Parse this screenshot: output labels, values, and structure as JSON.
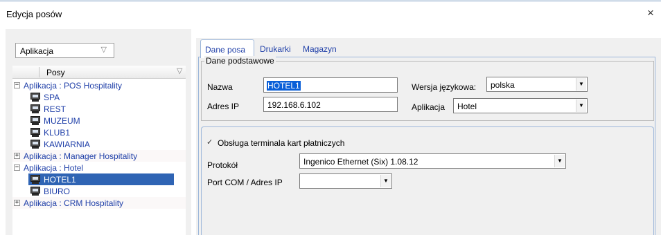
{
  "window": {
    "title": "Edycja posów",
    "close_glyph": "×"
  },
  "left": {
    "filter_combo": {
      "value": "Aplikacja",
      "arrow": "▽"
    },
    "tree_header": {
      "label": "Posy",
      "arrow": "▽"
    },
    "tree": [
      {
        "type": "group",
        "label": "Aplikacja : POS Hospitality",
        "expander": "−"
      },
      {
        "type": "leaf",
        "label": "SPA"
      },
      {
        "type": "leaf",
        "label": "REST"
      },
      {
        "type": "leaf",
        "label": "MUZEUM"
      },
      {
        "type": "leaf",
        "label": "KLUB1"
      },
      {
        "type": "leaf",
        "label": "KAWIARNIA"
      },
      {
        "type": "group",
        "label": "Aplikacja : Manager Hospitality",
        "expander": "+"
      },
      {
        "type": "group",
        "label": "Aplikacja : Hotel",
        "expander": "−"
      },
      {
        "type": "leaf",
        "label": "HOTEL1",
        "selected": true
      },
      {
        "type": "leaf",
        "label": "BIURO"
      },
      {
        "type": "group",
        "label": "Aplikacja : CRM Hospitality",
        "expander": "+"
      }
    ]
  },
  "tabs": [
    {
      "label": "Dane posa",
      "active": true
    },
    {
      "label": "Drukarki",
      "active": false
    },
    {
      "label": "Magazyn",
      "active": false
    }
  ],
  "basic_data": {
    "legend": "Dane podstawowe",
    "name_label": "Nazwa",
    "name_value": "HOTEL1",
    "ip_label": "Adres IP",
    "ip_value": "192.168.6.102",
    "lang_label": "Wersja językowa:",
    "lang_value": "polska",
    "app_label": "Aplikacja",
    "app_value": "Hotel"
  },
  "terminal": {
    "checkbox_label": "Obsługa terminala kart płatniczych",
    "checkbox_mark": "✓",
    "protocol_label": "Protokół",
    "protocol_value": "Ingenico Ethernet (Six) 1.08.12",
    "port_label": "Port COM / Adres IP",
    "port_value": ""
  },
  "colors": {
    "accent": "#2f64b4",
    "tab_border": "#9db7da",
    "link_text": "#1f3fa8"
  },
  "icons": {
    "dropdown": "▼",
    "workstation": "computer-icon"
  }
}
